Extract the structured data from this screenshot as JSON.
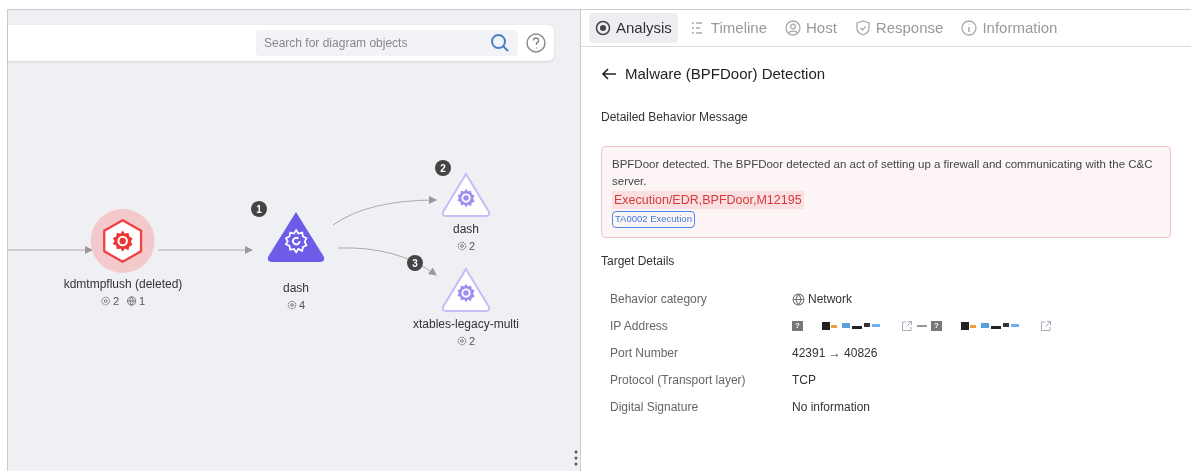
{
  "canvas": {
    "search": {
      "placeholder": "Search for diagram objects"
    },
    "nodes": [
      {
        "name": "kdmtmpflush (deleted)",
        "kind": "deleted",
        "stats": [
          {
            "kind": "process",
            "count": "2"
          },
          {
            "kind": "network",
            "count": "1"
          }
        ]
      },
      {
        "name": "dash",
        "kind": "active",
        "badge": "1",
        "stats": [
          {
            "kind": "process",
            "count": "4"
          }
        ]
      },
      {
        "name": "dash",
        "kind": "child",
        "badge": "2",
        "stats": [
          {
            "kind": "process",
            "count": "2"
          }
        ]
      },
      {
        "name": "xtables-legacy-multi",
        "kind": "child",
        "badge": "3",
        "stats": [
          {
            "kind": "process",
            "count": "2"
          }
        ]
      }
    ]
  },
  "tabs": [
    {
      "label": "Analysis",
      "selected": true
    },
    {
      "label": "Timeline",
      "selected": false
    },
    {
      "label": "Host",
      "selected": false
    },
    {
      "label": "Response",
      "selected": false
    },
    {
      "label": "Information",
      "selected": false
    }
  ],
  "detail": {
    "title": "Malware (BPFDoor) Detection",
    "message_heading": "Detailed Behavior Message",
    "message": "BPFDoor detected. The BPFDoor detected an act of setting up a firewall and communicating with the C&C server.",
    "tag": "Execution/EDR,BPFDoor,M12195",
    "tactic": "TA0002 Execution",
    "target_heading": "Target Details",
    "rows": [
      {
        "label": "Behavior category",
        "kind": "category",
        "value": "Network"
      },
      {
        "label": "IP Address",
        "kind": "ip",
        "source_flag": "?",
        "dest_flag": "?"
      },
      {
        "label": "Port Number",
        "kind": "text",
        "value": "42391 → 40826"
      },
      {
        "label": "Protocol (Transport layer)",
        "kind": "text",
        "value": "TCP"
      },
      {
        "label": "Digital Signature",
        "kind": "text",
        "value": "No information"
      }
    ]
  }
}
